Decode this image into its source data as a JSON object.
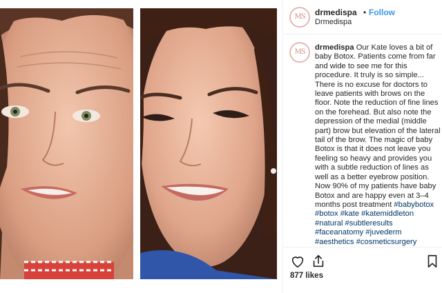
{
  "post": {
    "username": "drmedispa",
    "dot": "•",
    "follow_label": "Follow",
    "location": "Drmedispa",
    "avatar_monogram": "MS"
  },
  "caption": {
    "username": "drmedispa",
    "text": "Our Kate loves a bit of baby Botox. Patients come from far and wide to see me for this procedure. It truly is so simple... There is no excuse for doctors to leave patients with brows on the floor. Note the reduction of fine lines on the forehead. But also note the depression of the medial (middle part) brow but elevation of the lateral tail of the brow. The magic of baby Botox is that it does not leave you feeling so heavy and provides you with a subtle reduction of lines as well as a better eyebrow position. Now 90% of my patients have baby Botox and are happy even at 3–4 months post treatment",
    "hashtags": "#babybotox #botox #kate #katemiddleton #natural #subtleresults #faceanatomy #juvederm #aesthetics #cosmeticsurgery #plasticsurgery #drsomji"
  },
  "actions": {
    "like_icon": "heart-icon",
    "share_icon": "share-icon",
    "save_icon": "bookmark-icon",
    "likes": "877 likes"
  },
  "colors": {
    "link_blue": "#3897f0",
    "hashtag_blue": "#003569",
    "avatar_ring": "#e7b7b3"
  }
}
